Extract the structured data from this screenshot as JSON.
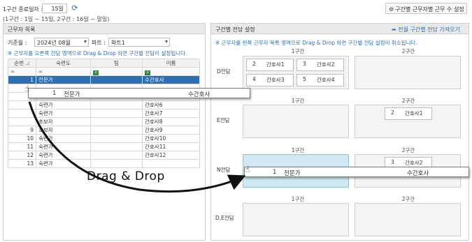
{
  "header": {
    "end_day_label": "1구간 종료일자 :",
    "end_day_value": "15일",
    "range_note": "(1구간 : 1일 ~ 15일, 2구간 : 16일 ~ 말일)",
    "settings_button": "구간별 근무자별 근무 수 설정"
  },
  "left": {
    "title": "근무자 목록",
    "month_label": "기준월 :",
    "month_value": "2024년 08월",
    "part_label": "파트 :",
    "part_value": "파트1",
    "instruction": "※ 근무자를 오른쪽 전담 영역으로 Drag & Drop 하면 구간별 전담이 설정됩니다.",
    "columns": [
      "순번",
      "숙련도",
      "팀",
      "이름"
    ],
    "filter_row": [
      "∞",
      "∞",
      "",
      ""
    ],
    "rows": [
      {
        "no": "1",
        "skill": "전문가",
        "team": "",
        "name": "수간호사",
        "selected": true
      },
      {
        "no": "",
        "skill": "",
        "team": "",
        "name": ""
      },
      {
        "no": "",
        "skill": "",
        "team": "",
        "name": ""
      },
      {
        "no": "",
        "skill": "숙련가",
        "team": "",
        "name": "간호사6"
      },
      {
        "no": "",
        "skill": "숙련가",
        "team": "",
        "name": "간호사7"
      },
      {
        "no": "",
        "skill": "초보자",
        "team": "",
        "name": "간호사8"
      },
      {
        "no": "9",
        "skill": "초보자",
        "team": "",
        "name": "간호사9"
      },
      {
        "no": "10",
        "skill": "숙련가",
        "team": "",
        "name": "간호사10"
      },
      {
        "no": "11",
        "skill": "숙련가",
        "team": "",
        "name": "간호사11"
      },
      {
        "no": "12",
        "skill": "숙련가",
        "team": "",
        "name": "간호사12"
      },
      {
        "no": "13",
        "skill": "숙련가",
        "team": "",
        "name": ""
      }
    ],
    "drag_ghost": {
      "no": "1",
      "skill": "전문가",
      "name": "수간호사"
    }
  },
  "right": {
    "title": "구간별 전담 설정",
    "import_link": "전월 구간별 전담 가져오기",
    "instruction": "※ 근무자를 왼쪽 근무자 목록 영역으로 Drag & Drop 하면 구간별 전담 설정이 취소됩니다.",
    "col1": "1구간",
    "col2": "2구간",
    "sections": {
      "d": {
        "label": "D전담",
        "z1": [
          {
            "no": "2",
            "name": "간호사1"
          },
          {
            "no": "3",
            "name": "간호사2"
          },
          {
            "no": "4",
            "name": "간호사3"
          },
          {
            "no": "5",
            "name": "간호사4"
          }
        ]
      },
      "e": {
        "label": "E전담",
        "z2": [
          {
            "no": "2",
            "name": "간호사1"
          }
        ]
      },
      "n": {
        "label": "N전담",
        "z2": [
          {
            "no": "3",
            "name": "간호사2"
          }
        ]
      },
      "de": {
        "label": "D,E전담"
      }
    },
    "drop_ghost": {
      "no": "1",
      "skill": "전문가",
      "name": "수간호사"
    }
  },
  "overlay": {
    "label": "Drag & Drop"
  }
}
